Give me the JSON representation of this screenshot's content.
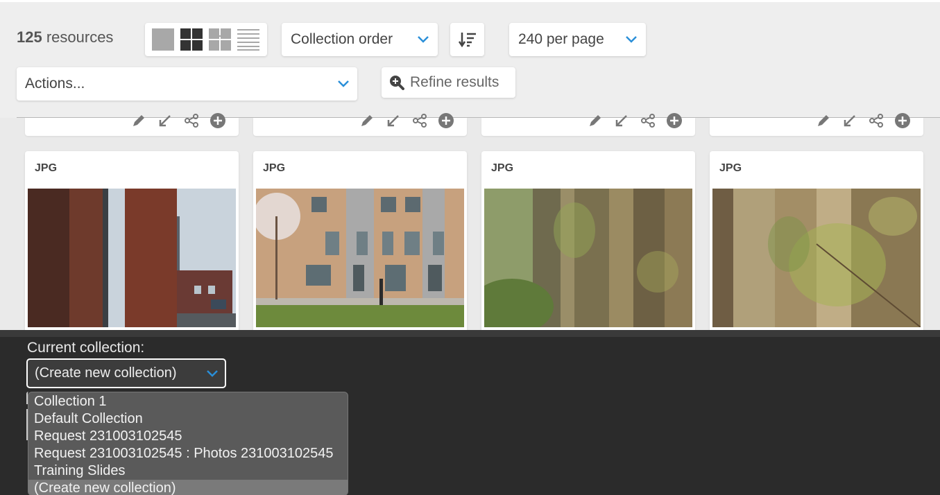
{
  "toolbar": {
    "count_number": "125",
    "count_label": " resources",
    "sort_label": "Collection order",
    "per_page_label": "240 per page",
    "actions_label": "Actions...",
    "refine_label": "Refine results"
  },
  "view_modes": [
    "large-thumbs",
    "medium-thumbs",
    "small-thumbs",
    "list"
  ],
  "cards": [
    {
      "type": "JPG"
    },
    {
      "type": "JPG"
    },
    {
      "type": "JPG"
    },
    {
      "type": "JPG"
    }
  ],
  "collection_bar": {
    "label": "Current collection:",
    "selected": "(Create new collection)",
    "options": [
      "Collection 1",
      "Default Collection",
      "Request 231003102545",
      "Request 231003102545 : Photos 231003102545",
      "Training Slides",
      "(Create new collection)"
    ],
    "selected_index": 5
  },
  "colors": {
    "accent": "#2a8fd8",
    "toolbar_bg": "#eeeeee",
    "collection_bar_bg": "#2b2b2b",
    "dropdown_bg": "#5a5a5a"
  }
}
